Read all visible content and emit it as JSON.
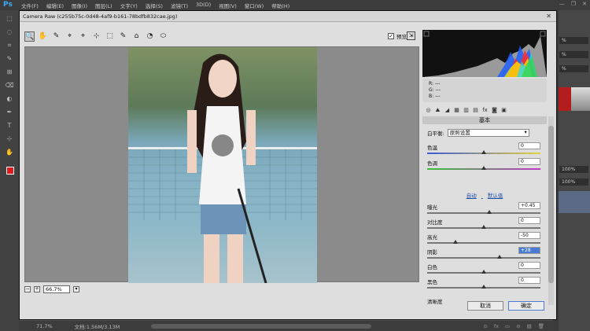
{
  "ps": {
    "logo": "Ps",
    "menu": [
      "文件(F)",
      "编辑(E)",
      "图像(I)",
      "图层(L)",
      "文字(Y)",
      "选择(S)",
      "滤镜(T)",
      "3D(D)",
      "视图(V)",
      "窗口(W)",
      "帮助(H)"
    ],
    "window_controls": {
      "minimize": "—",
      "restore": "❐",
      "close": "✕"
    },
    "tools": [
      "⬚",
      "◌",
      "⌗",
      "✎",
      "⊞",
      "⌫",
      "◐",
      "✒",
      "T",
      "⊹",
      "✋"
    ],
    "right_panel_fields": [
      "%",
      "%",
      "%",
      "100%",
      "100%"
    ],
    "status": {
      "zoom": "71.7%",
      "doc": "文档:1.56M/3.13M",
      "icons": [
        "⊙",
        "fx",
        "▭",
        "⊘",
        "▤",
        "🗑"
      ]
    },
    "colors": {
      "foreground": "#e01a1a",
      "accent": "#3fa9f5"
    }
  },
  "camera_raw": {
    "title": "Camera Raw (c255b75c-0d48-4af9-b161-78bdfb832cae.jpg)",
    "close": "✕",
    "tools": [
      "🔍",
      "✋",
      "✎",
      "⌖",
      "⌖",
      "⊹",
      "⬚",
      "✎",
      "⌂",
      "◔",
      "⬭"
    ],
    "preview_label": "预览",
    "preview_checked": "✓",
    "fullscreen": "⇲",
    "zoom": {
      "minus": "−",
      "plus": "+",
      "value": "66.7%",
      "dropdown": "▾"
    },
    "rgb": {
      "r_label": "R:",
      "g_label": "G:",
      "b_label": "B:",
      "r": "---",
      "g": "---",
      "b": "---"
    },
    "panel_tabs": [
      "◎",
      "⛰",
      "◢",
      "▦",
      "▥",
      "▤",
      "fx",
      "◙",
      "▣"
    ],
    "panel_title": "基本",
    "white_balance": {
      "label": "白平衡:",
      "value": "原照设置"
    },
    "temperature": {
      "label": "色温",
      "value": "0",
      "position": 0.5
    },
    "tint": {
      "label": "色调",
      "value": "0",
      "position": 0.5
    },
    "auto_label": "自动",
    "default_label": "默认值",
    "adjustments": [
      {
        "label": "曝光",
        "value": "+0.45",
        "position": 0.55,
        "selected": false
      },
      {
        "label": "对比度",
        "value": "0",
        "position": 0.5,
        "selected": false
      },
      {
        "label": "高光",
        "value": "-50",
        "position": 0.25,
        "selected": false
      },
      {
        "label": "阴影",
        "value": "+28",
        "position": 0.64,
        "selected": true
      },
      {
        "label": "白色",
        "value": "0",
        "position": 0.5,
        "selected": false
      },
      {
        "label": "黑色",
        "value": "0",
        "position": 0.5,
        "selected": false
      }
    ],
    "clarity_label": "清晰度",
    "cancel_label": "取消",
    "ok_label": "确定"
  }
}
